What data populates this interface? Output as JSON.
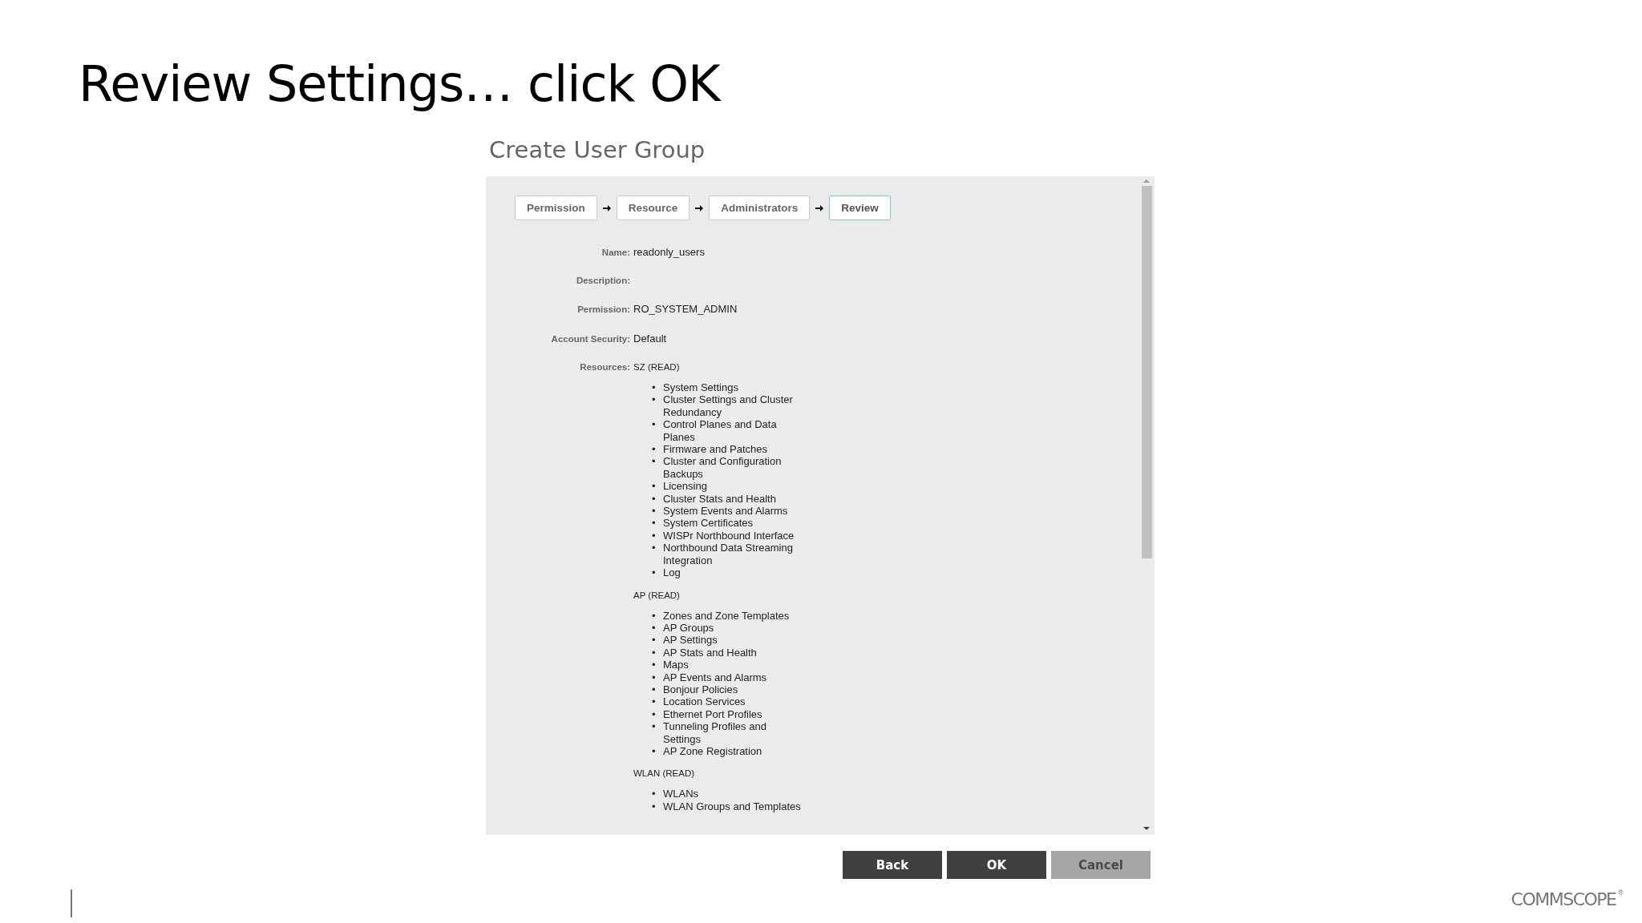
{
  "slide": {
    "title": "Review Settings… click OK"
  },
  "dialog": {
    "title": "Create User Group",
    "steps": [
      {
        "label": "Permission",
        "selected": false
      },
      {
        "label": "Resource",
        "selected": false
      },
      {
        "label": "Administrators",
        "selected": false
      },
      {
        "label": "Review",
        "selected": true
      }
    ],
    "fields": [
      {
        "label": "Name:",
        "value": "readonly_users"
      },
      {
        "label": "Description:"
      },
      {
        "label": "Permission:",
        "value": "RO_SYSTEM_ADMIN"
      },
      {
        "label": "Account Security:",
        "value": "Default"
      }
    ],
    "resources": {
      "label": "Resources:",
      "bullet": "•",
      "groups": [
        {
          "name": "SZ (READ)",
          "items": [
            "System Settings",
            "Cluster Settings and Cluster Redundancy",
            "Control Planes and Data Planes",
            "Firmware and Patches",
            "Cluster and Configuration Backups",
            "Licensing",
            "Cluster Stats and Health",
            "System Events and Alarms",
            "System Certificates",
            "WISPr Northbound Interface",
            "Northbound Data Streaming Integration",
            "Log"
          ]
        },
        {
          "name": "AP (READ)",
          "items": [
            "Zones and Zone Templates",
            "AP Groups",
            "AP Settings",
            "AP Stats and Health",
            "Maps",
            "AP Events and Alarms",
            "Bonjour Policies",
            "Location Services",
            "Ethernet Port Profiles",
            "Tunneling Profiles and Settings",
            "AP Zone Registration"
          ]
        },
        {
          "name": "WLAN (READ)",
          "items": [
            "WLANs",
            "WLAN Groups and Templates"
          ]
        }
      ]
    },
    "buttons": [
      {
        "label": "Back",
        "disabled": false
      },
      {
        "label": "OK",
        "disabled": false
      },
      {
        "label": "Cancel",
        "disabled": true
      }
    ]
  },
  "footer": {
    "logo": "COMMSCOPE",
    "mark": "®"
  }
}
